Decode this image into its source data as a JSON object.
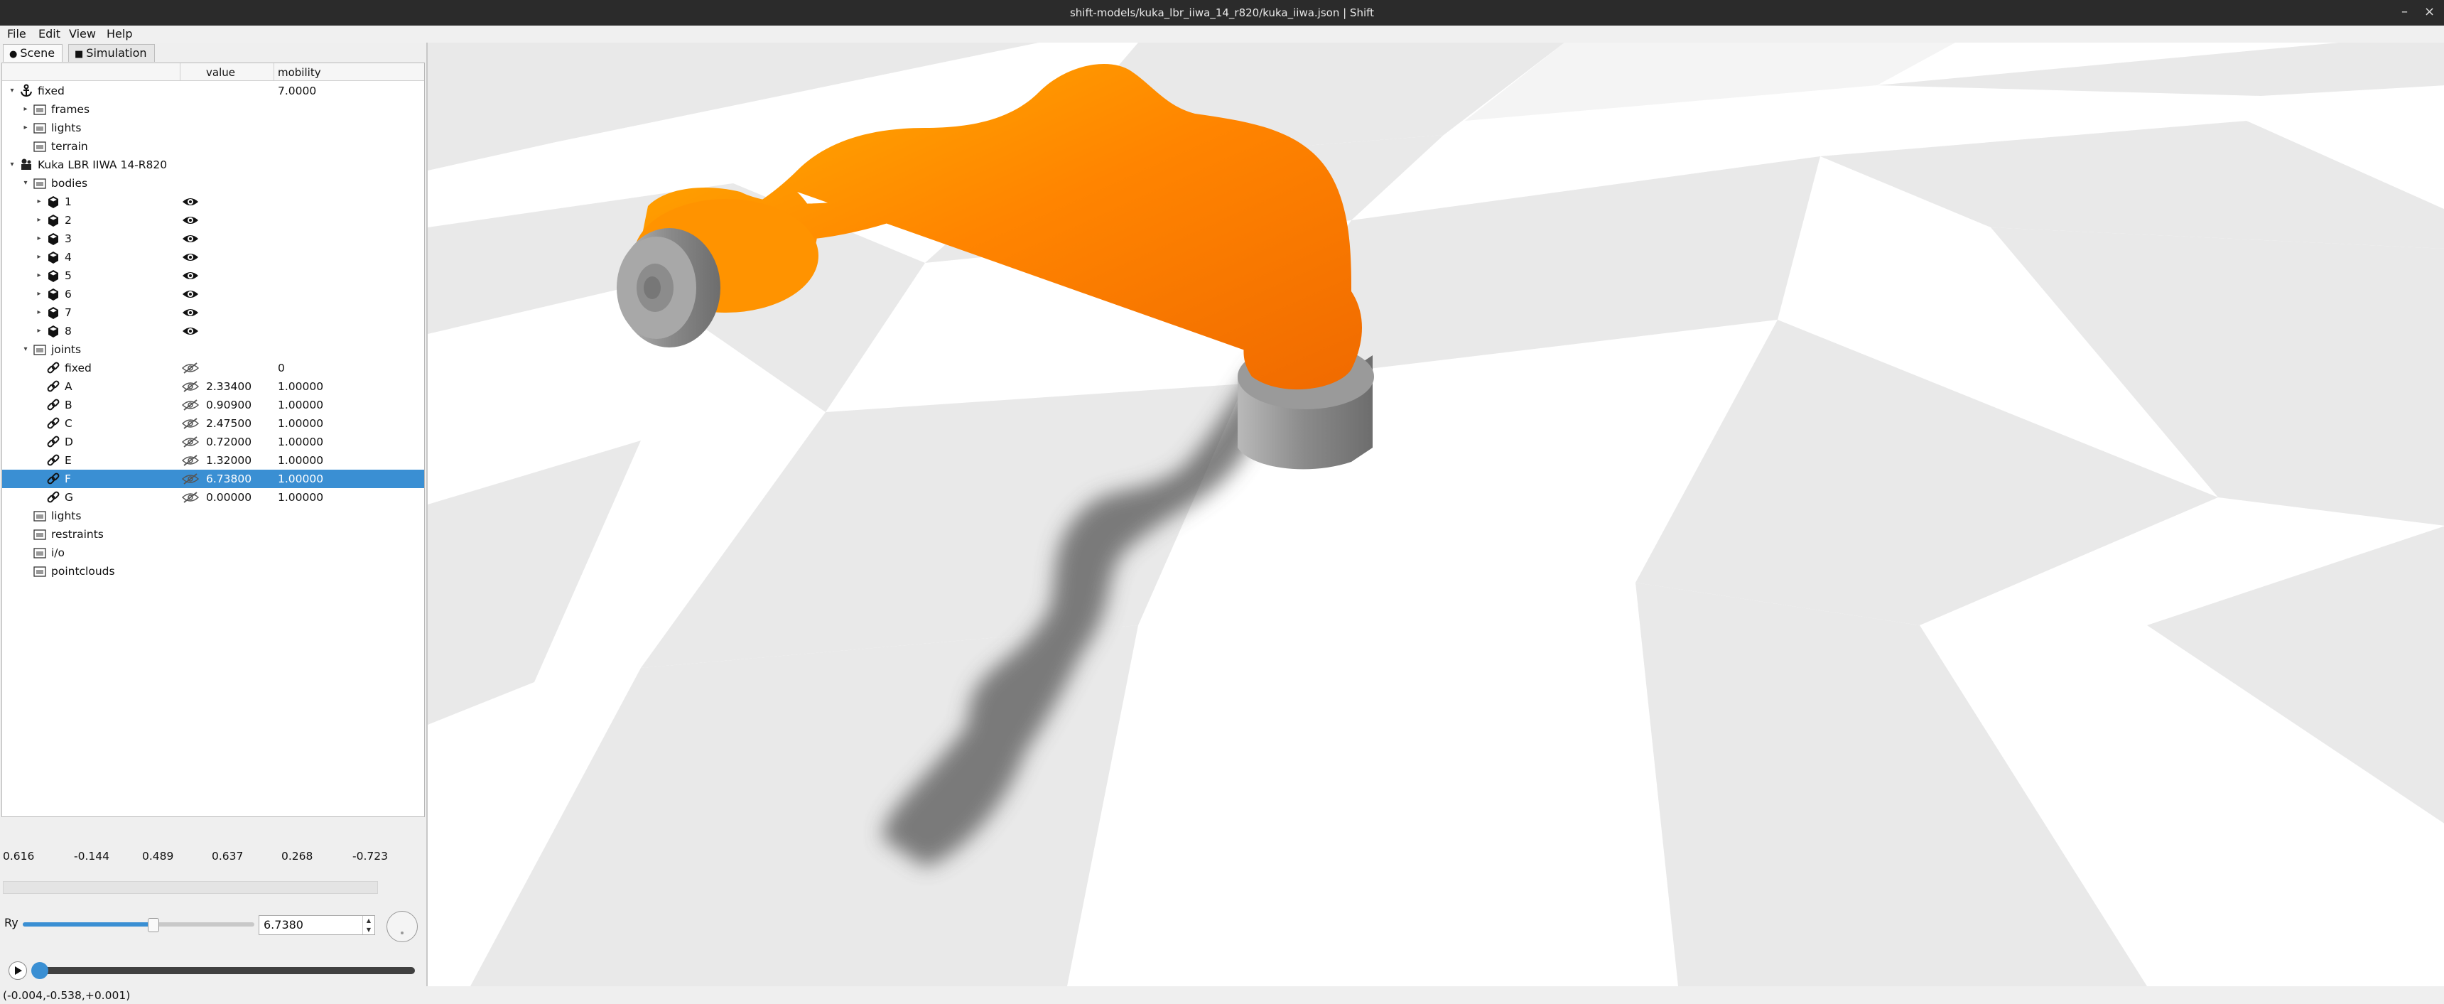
{
  "window": {
    "title": "shift-models/kuka_lbr_iiwa_14_r820/kuka_iiwa.json | Shift",
    "minimize": "–",
    "close": "×"
  },
  "menu": [
    "File",
    "Edit",
    "View",
    "Help"
  ],
  "tabs": [
    {
      "label": "Scene",
      "icon": "scene-icon",
      "active": true
    },
    {
      "label": "Simulation",
      "icon": "clapper-icon",
      "active": false
    }
  ],
  "tree": {
    "columns": {
      "name": "",
      "value": "value",
      "mobility": "mobility"
    },
    "rows": [
      {
        "label": "fixed",
        "icon": "anchor-icon",
        "depth": 0,
        "expand": "down",
        "mobility": "7.0000"
      },
      {
        "label": "frames",
        "icon": "folder-icon",
        "depth": 1,
        "expand": "right"
      },
      {
        "label": "lights",
        "icon": "folder-icon",
        "depth": 1,
        "expand": "right"
      },
      {
        "label": "terrain",
        "icon": "folder-icon",
        "depth": 1,
        "expand": ""
      },
      {
        "label": "Kuka LBR IIWA 14-R820",
        "icon": "robot-icon",
        "depth": 0,
        "expand": "down"
      },
      {
        "label": "bodies",
        "icon": "folder-icon",
        "depth": 1,
        "expand": "down"
      },
      {
        "label": "1",
        "icon": "cube-icon",
        "depth": 2,
        "expand": "right",
        "eye": "eye-icon"
      },
      {
        "label": "2",
        "icon": "cube-icon",
        "depth": 2,
        "expand": "right",
        "eye": "eye-icon"
      },
      {
        "label": "3",
        "icon": "cube-icon",
        "depth": 2,
        "expand": "right",
        "eye": "eye-icon"
      },
      {
        "label": "4",
        "icon": "cube-icon",
        "depth": 2,
        "expand": "right",
        "eye": "eye-icon"
      },
      {
        "label": "5",
        "icon": "cube-icon",
        "depth": 2,
        "expand": "right",
        "eye": "eye-icon"
      },
      {
        "label": "6",
        "icon": "cube-icon",
        "depth": 2,
        "expand": "right",
        "eye": "eye-icon"
      },
      {
        "label": "7",
        "icon": "cube-icon",
        "depth": 2,
        "expand": "right",
        "eye": "eye-icon"
      },
      {
        "label": "8",
        "icon": "cube-icon",
        "depth": 2,
        "expand": "right",
        "eye": "eye-icon"
      },
      {
        "label": "joints",
        "icon": "folder-icon",
        "depth": 1,
        "expand": "down"
      },
      {
        "label": "fixed",
        "icon": "link-icon",
        "depth": 2,
        "expand": "",
        "eye": "eye-off-icon",
        "mobility": "0"
      },
      {
        "label": "A",
        "icon": "link-icon",
        "depth": 2,
        "expand": "",
        "eye": "eye-off-icon",
        "value": "2.33400",
        "mobility": "1.00000"
      },
      {
        "label": "B",
        "icon": "link-icon",
        "depth": 2,
        "expand": "",
        "eye": "eye-off-icon",
        "value": "0.90900",
        "mobility": "1.00000"
      },
      {
        "label": "C",
        "icon": "link-icon",
        "depth": 2,
        "expand": "",
        "eye": "eye-off-icon",
        "value": "2.47500",
        "mobility": "1.00000"
      },
      {
        "label": "D",
        "icon": "link-icon",
        "depth": 2,
        "expand": "",
        "eye": "eye-off-icon",
        "value": "0.72000",
        "mobility": "1.00000"
      },
      {
        "label": "E",
        "icon": "link-icon",
        "depth": 2,
        "expand": "",
        "eye": "eye-off-icon",
        "value": "1.32000",
        "mobility": "1.00000"
      },
      {
        "label": "F",
        "icon": "link-icon",
        "depth": 2,
        "expand": "",
        "eye": "eye-off-icon",
        "value": "6.73800",
        "mobility": "1.00000",
        "selected": true
      },
      {
        "label": "G",
        "icon": "link-icon",
        "depth": 2,
        "expand": "",
        "eye": "eye-off-icon",
        "value": "0.00000",
        "mobility": "1.00000"
      },
      {
        "label": "lights",
        "icon": "folder-icon",
        "depth": 1,
        "expand": ""
      },
      {
        "label": "restraints",
        "icon": "folder-icon",
        "depth": 1,
        "expand": ""
      },
      {
        "label": "i/o",
        "icon": "folder-icon",
        "depth": 1,
        "expand": ""
      },
      {
        "label": "pointclouds",
        "icon": "folder-icon",
        "depth": 1,
        "expand": ""
      }
    ]
  },
  "readout": [
    "0.616",
    "-0.144",
    "0.489",
    "0.637",
    "0.268",
    "-0.723"
  ],
  "control": {
    "label": "Ry",
    "value": "6.7380",
    "slider_fraction": 0.56
  },
  "timeline": {
    "position_fraction": 0.0,
    "play_icon": "play-icon"
  },
  "status": "(-0.004,-0.538,+0.001)",
  "colors": {
    "selection": "#3a8fd3",
    "robot_orange": "#ff7b00",
    "robot_grey": "#8a8a8a"
  }
}
